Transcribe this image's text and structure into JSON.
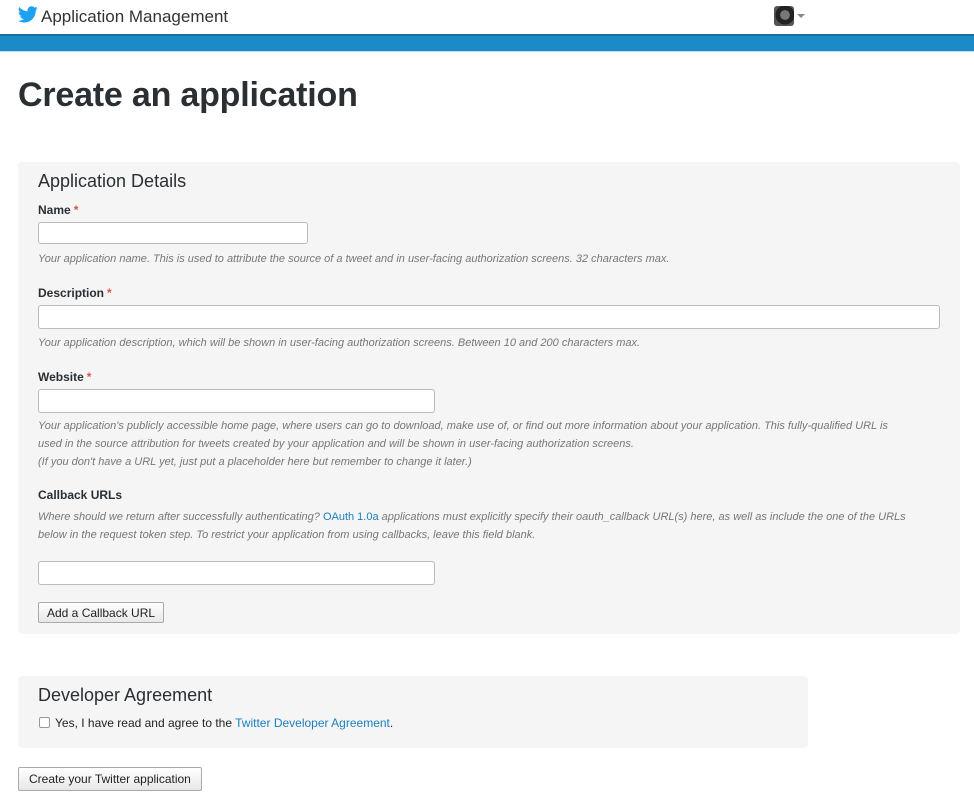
{
  "header": {
    "brand_icon": "twitter-bird-icon",
    "title": "Application Management",
    "accent_color": "#1b8bc7"
  },
  "page_title": "Create an application",
  "details": {
    "heading": "Application Details",
    "name": {
      "label": "Name",
      "required_mark": "*",
      "value": "",
      "help": "Your application name. This is used to attribute the source of a tweet and in user-facing authorization screens. 32 characters max."
    },
    "description": {
      "label": "Description",
      "required_mark": "*",
      "value": "",
      "help": "Your application description, which will be shown in user-facing authorization screens. Between 10 and 200 characters max."
    },
    "website": {
      "label": "Website",
      "required_mark": "*",
      "value": "",
      "help_line1": "Your application's publicly accessible home page, where users can go to download, make use of, or find out more information about your application. This fully-qualified URL is",
      "help_line2": "used in the source attribution for tweets created by your application and will be shown in user-facing authorization screens.",
      "help_line3": "(If you don't have a URL yet, just put a placeholder here but remember to change it later.)"
    },
    "callback": {
      "label": "Callback URLs",
      "help_prefix": "Where should we return after successfully authenticating? ",
      "help_link": "OAuth 1.0a",
      "help_line1_suffix": " applications must explicitly specify their oauth_callback URL(s) here, as well as include the one of the URLs",
      "help_line2": "below in the request token step. To restrict your application from using callbacks, leave this field blank.",
      "value": "",
      "add_button": "Add a Callback URL"
    }
  },
  "agreement": {
    "heading": "Developer Agreement",
    "checked": false,
    "text_prefix": "Yes, I have read and agree to the ",
    "link": "Twitter Developer Agreement",
    "text_suffix": "."
  },
  "submit_button": "Create your Twitter application"
}
